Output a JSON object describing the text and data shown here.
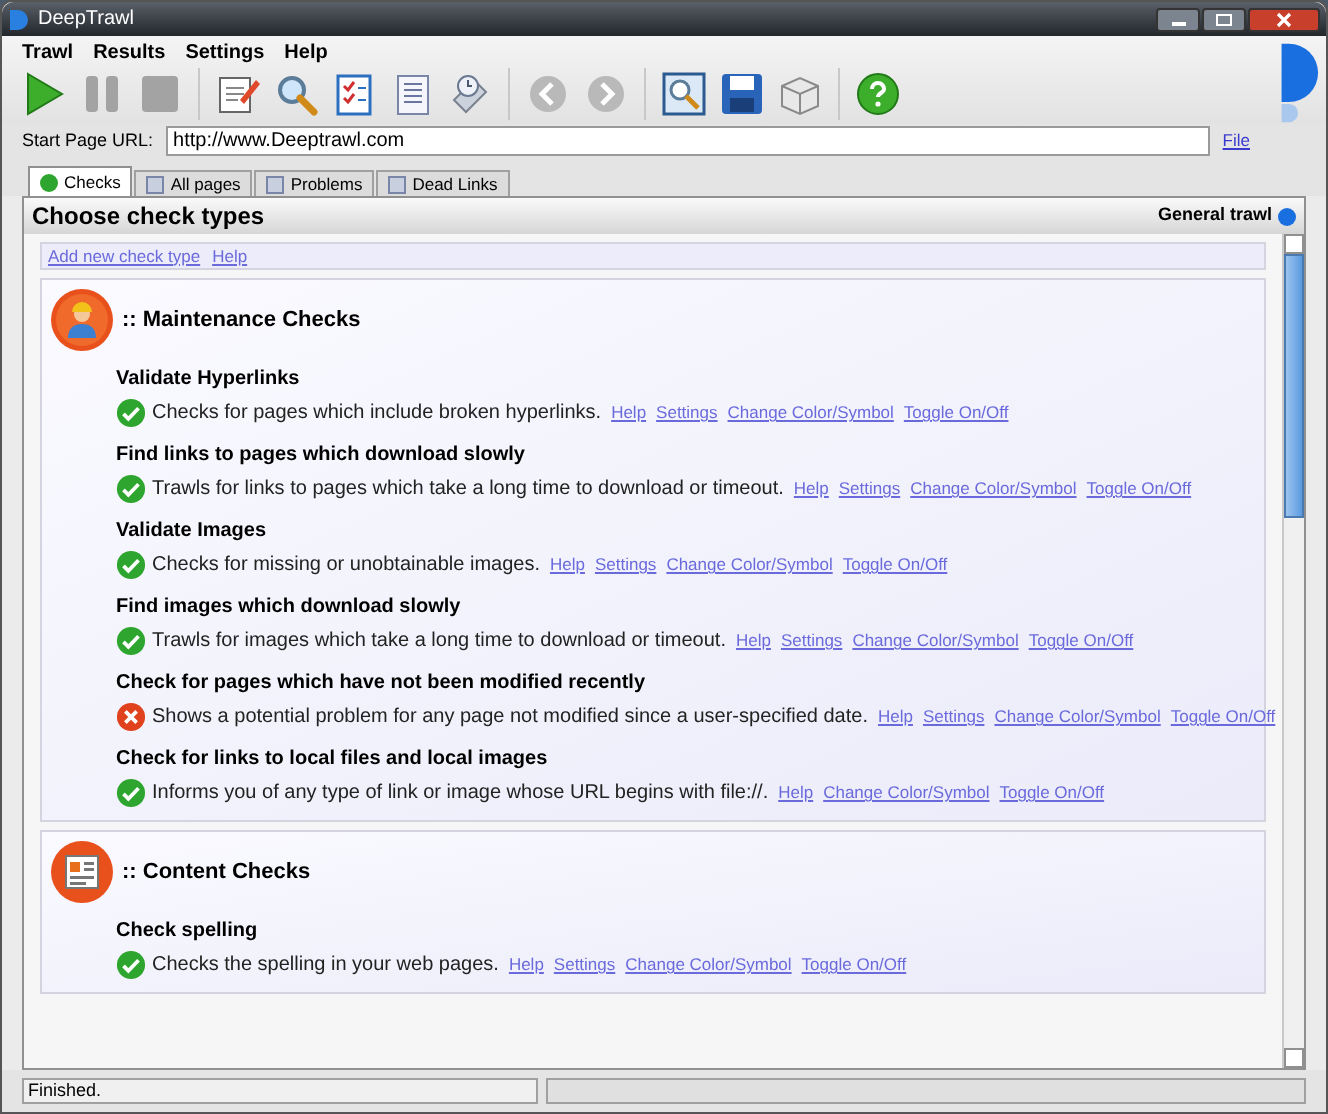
{
  "window": {
    "title": "DeepTrawl"
  },
  "menu": [
    "Trawl",
    "Results",
    "Settings",
    "Help"
  ],
  "url": {
    "label": "Start Page URL:",
    "value": "http://www.Deeptrawl.com",
    "link": "File"
  },
  "tabs": [
    {
      "label": "Checks",
      "selected": true
    },
    {
      "label": "All pages",
      "selected": false
    },
    {
      "label": "Problems",
      "selected": false
    },
    {
      "label": "Dead Links",
      "selected": false
    }
  ],
  "panel": {
    "title": "Choose check types",
    "mode": "General trawl"
  },
  "top_links": [
    "Add new check type",
    "Help"
  ],
  "sections": [
    {
      "title": ":: Maintenance Checks",
      "kind": "maintenance",
      "checks": [
        {
          "title": "Validate Hyperlinks",
          "on": true,
          "description": "Checks for pages which include broken hyperlinks.",
          "links": [
            "Help",
            "Settings",
            "Change Color/Symbol",
            "Toggle On/Off"
          ]
        },
        {
          "title": "Find links to pages which download slowly",
          "on": true,
          "description": "Trawls for links to pages which take a long time to download or timeout.",
          "links": [
            "Help",
            "Settings",
            "Change Color/Symbol",
            "Toggle On/Off"
          ]
        },
        {
          "title": "Validate Images",
          "on": true,
          "description": "Checks for missing or unobtainable images.",
          "links": [
            "Help",
            "Settings",
            "Change Color/Symbol",
            "Toggle On/Off"
          ]
        },
        {
          "title": "Find images which download slowly",
          "on": true,
          "description": "Trawls for images which take a long time to download or timeout.",
          "links": [
            "Help",
            "Settings",
            "Change Color/Symbol",
            "Toggle On/Off"
          ]
        },
        {
          "title": "Check for pages which have not been modified recently",
          "on": false,
          "description": "Shows a potential problem for any page not modified since a user-specified date.",
          "links": [
            "Help",
            "Settings",
            "Change Color/Symbol",
            "Toggle On/Off"
          ]
        },
        {
          "title": "Check for links to local files and local images",
          "on": true,
          "description": "Informs you of any type of link or image whose URL begins with file://.",
          "links": [
            "Help",
            "Change Color/Symbol",
            "Toggle On/Off"
          ]
        }
      ]
    },
    {
      "title": ":: Content Checks",
      "kind": "content",
      "checks": [
        {
          "title": "Check spelling",
          "on": true,
          "description": "Checks the spelling in your web pages.",
          "links": [
            "Help",
            "Settings",
            "Change Color/Symbol",
            "Toggle On/Off"
          ]
        }
      ]
    }
  ],
  "status_bar": {
    "text": "Finished."
  }
}
